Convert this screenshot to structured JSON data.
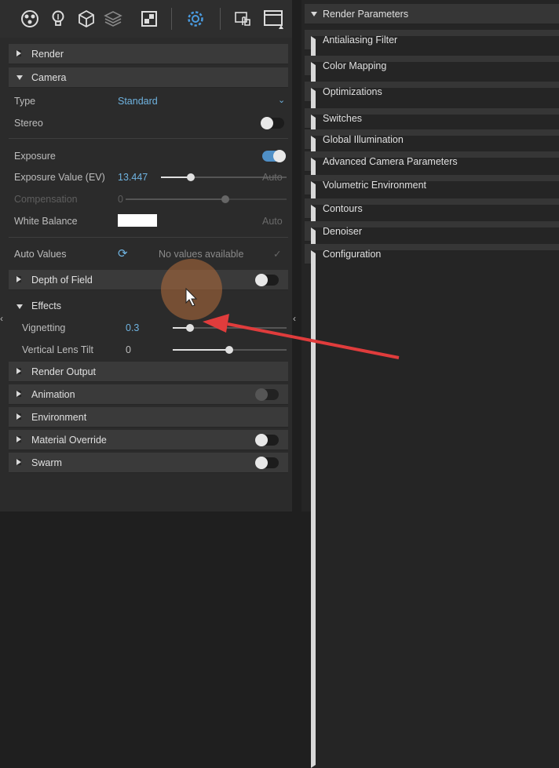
{
  "left_panel": {
    "sections": {
      "render": "Render",
      "camera": "Camera",
      "depth_of_field": "Depth of Field",
      "effects": "Effects",
      "render_output": "Render Output",
      "animation": "Animation",
      "environment": "Environment",
      "material_override": "Material Override",
      "swarm": "Swarm"
    },
    "camera": {
      "type_label": "Type",
      "type_value": "Standard",
      "stereo_label": "Stereo",
      "exposure_label": "Exposure",
      "exposure_value_label": "Exposure Value (EV)",
      "exposure_value": "13.447",
      "exposure_auto": "Auto",
      "compensation_label": "Compensation",
      "compensation_value": "0",
      "white_balance_label": "White Balance",
      "white_balance_auto": "Auto",
      "white_balance_color": "#ffffff",
      "auto_values_label": "Auto Values",
      "auto_values_status": "No values available"
    },
    "effects": {
      "vignetting_label": "Vignetting",
      "vignetting_value": "0.3",
      "lens_tilt_label": "Vertical Lens Tilt",
      "lens_tilt_value": "0"
    },
    "toggles": {
      "stereo": "off",
      "exposure": "on",
      "depth_of_field": "off",
      "animation": "off",
      "material_override": "off",
      "swarm": "off"
    }
  },
  "right_panel": {
    "sections": [
      "Render Parameters",
      "Antialiasing Filter",
      "Color Mapping",
      "Optimizations",
      "Switches",
      "Global Illumination",
      "Advanced Camera Parameters",
      "Volumetric Environment",
      "Contours",
      "Denoiser",
      "Configuration"
    ]
  },
  "icons": {
    "toolbar": [
      "material-ball-icon",
      "light-bulb-icon",
      "cube-icon",
      "layers-icon",
      "texture-icon",
      "settings-gear-icon",
      "touch-render-icon",
      "window-icon"
    ]
  },
  "colors": {
    "accent": "#6fb3e0",
    "annotation_arrow": "#e03c3c"
  }
}
